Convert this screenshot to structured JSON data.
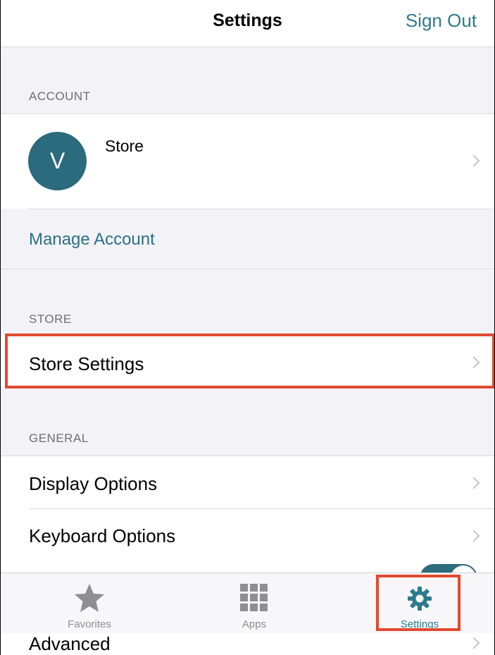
{
  "header": {
    "title": "Settings",
    "action_label": "Sign Out"
  },
  "account": {
    "section_label": "ACCOUNT",
    "avatar_initial": "V",
    "name": "Store",
    "manage_label": "Manage Account"
  },
  "store": {
    "section_label": "STORE",
    "settings_label": "Store Settings"
  },
  "general": {
    "section_label": "GENERAL",
    "display_label": "Display Options",
    "keyboard_label": "Keyboard Options",
    "advanced_label": "Advanced"
  },
  "tabs": [
    {
      "label": "Favorites",
      "icon": "star-icon",
      "active": false
    },
    {
      "label": "Apps",
      "icon": "grid-icon",
      "active": false
    },
    {
      "label": "Settings",
      "icon": "gear-icon",
      "active": true
    }
  ],
  "colors": {
    "accent": "#2e7a8e",
    "avatar": "#2c6a7d",
    "highlight": "#e04a2f"
  }
}
